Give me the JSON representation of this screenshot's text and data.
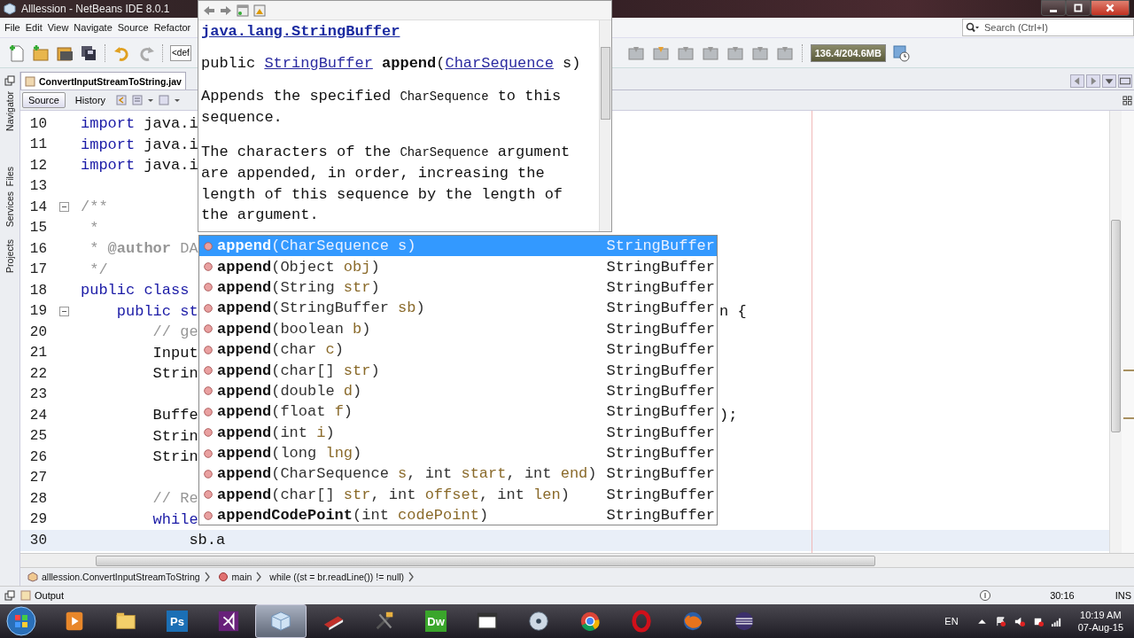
{
  "window": {
    "title": "Alllession - NetBeans IDE 8.0.1"
  },
  "menu": [
    "File",
    "Edit",
    "View",
    "Navigate",
    "Source",
    "Refactor"
  ],
  "search": {
    "placeholder": "Search (Ctrl+I)"
  },
  "toolbar": {
    "config": "<def",
    "memory": "136.4/204.6MB"
  },
  "side_tabs": [
    "Navigator",
    "Files",
    "Services",
    "Projects"
  ],
  "editor": {
    "tab": "ConvertInputStreamToString.jav",
    "views": [
      {
        "label": "Source",
        "selected": true
      },
      {
        "label": "History",
        "selected": false
      }
    ],
    "lines": [
      {
        "number": "10",
        "fold": false,
        "current": false,
        "code": [
          {
            "text": "import",
            "kind": "keyword"
          },
          {
            "text": " java.i",
            "kind": "plain"
          }
        ]
      },
      {
        "number": "11",
        "fold": false,
        "current": false,
        "code": [
          {
            "text": "import",
            "kind": "keyword"
          },
          {
            "text": " java.i",
            "kind": "plain"
          }
        ]
      },
      {
        "number": "12",
        "fold": false,
        "current": false,
        "code": [
          {
            "text": "import",
            "kind": "keyword"
          },
          {
            "text": " java.i",
            "kind": "plain"
          }
        ]
      },
      {
        "number": "13",
        "fold": false,
        "current": false
      },
      {
        "number": "14",
        "fold": true,
        "current": false,
        "code": [
          {
            "text": "/**",
            "kind": "comment"
          }
        ]
      },
      {
        "number": "15",
        "fold": false,
        "current": false,
        "code": [
          {
            "text": " *",
            "kind": "comment"
          }
        ]
      },
      {
        "number": "16",
        "fold": false,
        "current": false,
        "code": [
          {
            "text": " * ",
            "kind": "comment"
          },
          {
            "text": "@author",
            "kind": "tag"
          },
          {
            "text": " DA",
            "kind": "comment"
          }
        ]
      },
      {
        "number": "17",
        "fold": false,
        "current": false,
        "code": [
          {
            "text": " */",
            "kind": "comment"
          }
        ]
      },
      {
        "number": "18",
        "fold": false,
        "current": false,
        "code": [
          {
            "text": "public class",
            "kind": "keyword"
          }
        ]
      },
      {
        "number": "19",
        "fold": true,
        "current": false,
        "code": [
          {
            "text": "    public st",
            "kind": "keyword"
          }
        ],
        "tail": "n {"
      },
      {
        "number": "20",
        "fold": false,
        "current": false,
        "code": [
          {
            "text": "        // ge",
            "kind": "comment"
          }
        ]
      },
      {
        "number": "21",
        "fold": false,
        "current": false,
        "code": [
          {
            "text": "        Input",
            "kind": "plain"
          }
        ]
      },
      {
        "number": "22",
        "fold": false,
        "current": false,
        "code": [
          {
            "text": "        Strin",
            "kind": "plain"
          }
        ]
      },
      {
        "number": "23",
        "fold": false,
        "current": false
      },
      {
        "number": "24",
        "fold": false,
        "current": false,
        "code": [
          {
            "text": "        Buffe",
            "kind": "plain"
          }
        ],
        "tail": ");"
      },
      {
        "number": "25",
        "fold": false,
        "current": false,
        "code": [
          {
            "text": "        Strin",
            "kind": "plain"
          }
        ]
      },
      {
        "number": "26",
        "fold": false,
        "current": false,
        "code": [
          {
            "text": "        Strin",
            "kind": "plain"
          }
        ]
      },
      {
        "number": "27",
        "fold": false,
        "current": false
      },
      {
        "number": "28",
        "fold": false,
        "current": false,
        "code": [
          {
            "text": "        // Re",
            "kind": "comment"
          }
        ]
      },
      {
        "number": "29",
        "fold": false,
        "current": false,
        "code": [
          {
            "text": "        while",
            "kind": "keyword"
          }
        ]
      },
      {
        "number": "30",
        "fold": false,
        "current": true,
        "code": [
          {
            "text": "            sb.a",
            "kind": "plain"
          }
        ]
      }
    ]
  },
  "documentation": {
    "title": "java.lang.StringBuffer",
    "signature": [
      {
        "text": "public ",
        "kind": "plain"
      },
      {
        "text": "StringBuffer",
        "kind": "link"
      },
      {
        "text": " append",
        "kind": "bold"
      },
      {
        "text": "(",
        "kind": "plain"
      },
      {
        "text": "CharSequence",
        "kind": "link"
      },
      {
        "text": " s)",
        "kind": "plain"
      }
    ],
    "paragraphs": [
      [
        {
          "text": "Appends the specified ",
          "kind": "plain"
        },
        {
          "text": "CharSequence",
          "kind": "code"
        },
        {
          "text": " to this sequence.",
          "kind": "plain"
        }
      ],
      [
        {
          "text": "The characters of the ",
          "kind": "plain"
        },
        {
          "text": "CharSequence",
          "kind": "code"
        },
        {
          "text": " argument are appended, in order, increasing the length of this sequence by the length of the argument.",
          "kind": "plain"
        }
      ]
    ]
  },
  "completion": {
    "items": [
      {
        "name": "append",
        "params": [
          {
            "text": "(CharSequence ",
            "kind": "type"
          },
          {
            "text": "s",
            "kind": "param"
          },
          {
            "text": ")",
            "kind": "type"
          }
        ],
        "type": "StringBuffer",
        "selected": true
      },
      {
        "name": "append",
        "params": [
          {
            "text": "(Object ",
            "kind": "type"
          },
          {
            "text": "obj",
            "kind": "param"
          },
          {
            "text": ")",
            "kind": "type"
          }
        ],
        "type": "StringBuffer",
        "selected": false
      },
      {
        "name": "append",
        "params": [
          {
            "text": "(String ",
            "kind": "type"
          },
          {
            "text": "str",
            "kind": "param"
          },
          {
            "text": ")",
            "kind": "type"
          }
        ],
        "type": "StringBuffer",
        "selected": false
      },
      {
        "name": "append",
        "params": [
          {
            "text": "(StringBuffer ",
            "kind": "type"
          },
          {
            "text": "sb",
            "kind": "param"
          },
          {
            "text": ")",
            "kind": "type"
          }
        ],
        "type": "StringBuffer",
        "selected": false
      },
      {
        "name": "append",
        "params": [
          {
            "text": "(boolean ",
            "kind": "type"
          },
          {
            "text": "b",
            "kind": "param"
          },
          {
            "text": ")",
            "kind": "type"
          }
        ],
        "type": "StringBuffer",
        "selected": false
      },
      {
        "name": "append",
        "params": [
          {
            "text": "(char ",
            "kind": "type"
          },
          {
            "text": "c",
            "kind": "param"
          },
          {
            "text": ")",
            "kind": "type"
          }
        ],
        "type": "StringBuffer",
        "selected": false
      },
      {
        "name": "append",
        "params": [
          {
            "text": "(char[] ",
            "kind": "type"
          },
          {
            "text": "str",
            "kind": "param"
          },
          {
            "text": ")",
            "kind": "type"
          }
        ],
        "type": "StringBuffer",
        "selected": false
      },
      {
        "name": "append",
        "params": [
          {
            "text": "(double ",
            "kind": "type"
          },
          {
            "text": "d",
            "kind": "param"
          },
          {
            "text": ")",
            "kind": "type"
          }
        ],
        "type": "StringBuffer",
        "selected": false
      },
      {
        "name": "append",
        "params": [
          {
            "text": "(float ",
            "kind": "type"
          },
          {
            "text": "f",
            "kind": "param"
          },
          {
            "text": ")",
            "kind": "type"
          }
        ],
        "type": "StringBuffer",
        "selected": false
      },
      {
        "name": "append",
        "params": [
          {
            "text": "(int ",
            "kind": "type"
          },
          {
            "text": "i",
            "kind": "param"
          },
          {
            "text": ")",
            "kind": "type"
          }
        ],
        "type": "StringBuffer",
        "selected": false
      },
      {
        "name": "append",
        "params": [
          {
            "text": "(long ",
            "kind": "type"
          },
          {
            "text": "lng",
            "kind": "param"
          },
          {
            "text": ")",
            "kind": "type"
          }
        ],
        "type": "StringBuffer",
        "selected": false
      },
      {
        "name": "append",
        "params": [
          {
            "text": "(CharSequence ",
            "kind": "type"
          },
          {
            "text": "s",
            "kind": "param"
          },
          {
            "text": ", int ",
            "kind": "type"
          },
          {
            "text": "start",
            "kind": "param"
          },
          {
            "text": ", int ",
            "kind": "type"
          },
          {
            "text": "end",
            "kind": "param"
          },
          {
            "text": ")",
            "kind": "type"
          }
        ],
        "type": "StringBuffer",
        "selected": false
      },
      {
        "name": "append",
        "params": [
          {
            "text": "(char[] ",
            "kind": "type"
          },
          {
            "text": "str",
            "kind": "param"
          },
          {
            "text": ", int ",
            "kind": "type"
          },
          {
            "text": "offset",
            "kind": "param"
          },
          {
            "text": ", int ",
            "kind": "type"
          },
          {
            "text": "len",
            "kind": "param"
          },
          {
            "text": ")",
            "kind": "type"
          }
        ],
        "type": "StringBuffer",
        "selected": false
      },
      {
        "name": "appendCodePoint",
        "params": [
          {
            "text": "(int ",
            "kind": "type"
          },
          {
            "text": "codePoint",
            "kind": "param"
          },
          {
            "text": ")",
            "kind": "type"
          }
        ],
        "type": "StringBuffer",
        "selected": false
      }
    ]
  },
  "breadcrumbs": [
    {
      "label": "alllession.ConvertInputStreamToString",
      "kind": "class"
    },
    {
      "label": "main",
      "kind": "method"
    },
    {
      "label": "while ((st = br.readLine()) != null)",
      "kind": "statement"
    }
  ],
  "status_bar": {
    "output": "Output",
    "position": "30:16",
    "mode": "INS"
  },
  "taskbar": {
    "items": [
      {
        "kind": "media",
        "selected": false
      },
      {
        "kind": "folder",
        "selected": false
      },
      {
        "kind": "letters",
        "label": "Ps",
        "color": "#1b6fb5",
        "selected": false
      },
      {
        "kind": "vs",
        "selected": false
      },
      {
        "kind": "cube",
        "selected": true
      },
      {
        "kind": "book",
        "selected": false
      },
      {
        "kind": "tools",
        "selected": false
      },
      {
        "kind": "letters",
        "label": "Dw",
        "color": "#3aa62b",
        "selected": false
      },
      {
        "kind": "window",
        "selected": false
      },
      {
        "kind": "disc",
        "selected": false
      },
      {
        "kind": "chrome",
        "selected": false
      },
      {
        "kind": "opera",
        "selected": false
      },
      {
        "kind": "firefox",
        "selected": false
      },
      {
        "kind": "eclipse",
        "selected": false
      }
    ],
    "language": "EN",
    "time": "10:19 AM",
    "date": "07-Aug-15"
  }
}
